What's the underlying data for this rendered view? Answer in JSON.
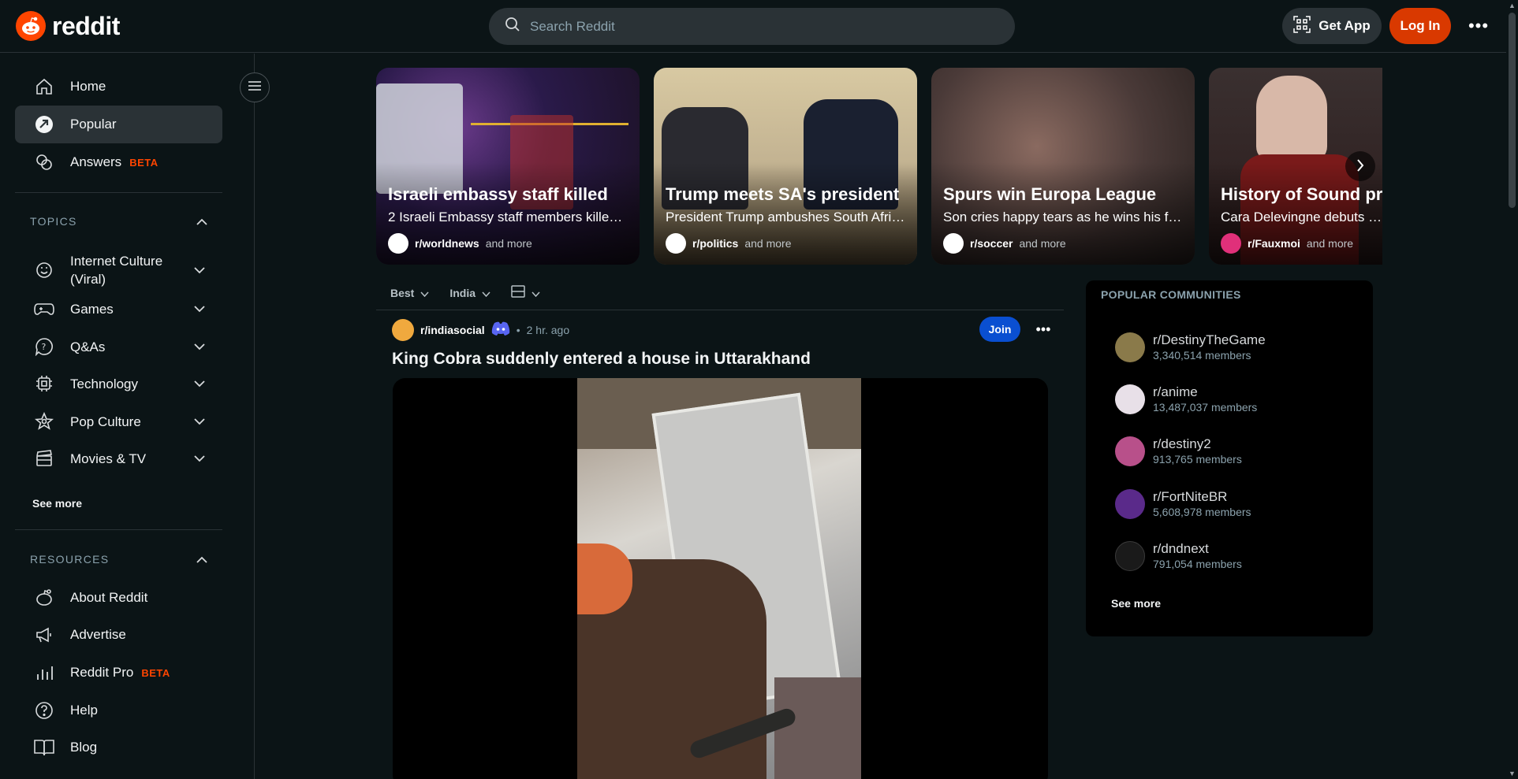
{
  "header": {
    "logo_text": "reddit",
    "search_placeholder": "Search Reddit",
    "get_app_label": "Get App",
    "login_label": "Log In",
    "more_icon": "ellipsis-icon"
  },
  "sidebar": {
    "main_items": [
      {
        "label": "Home",
        "icon": "home-icon"
      },
      {
        "label": "Popular",
        "icon": "popular-icon",
        "active": true
      },
      {
        "label": "Answers",
        "icon": "answers-icon",
        "badge": "BETA"
      }
    ],
    "topics_header": "TOPICS",
    "topics": [
      {
        "label": "Internet Culture (Viral)",
        "icon": "internet-culture-icon"
      },
      {
        "label": "Games",
        "icon": "gamepad-icon"
      },
      {
        "label": "Q&As",
        "icon": "question-icon"
      },
      {
        "label": "Technology",
        "icon": "chip-icon"
      },
      {
        "label": "Pop Culture",
        "icon": "star-icon"
      },
      {
        "label": "Movies & TV",
        "icon": "clapperboard-icon"
      }
    ],
    "see_more": "See more",
    "resources_header": "RESOURCES",
    "resources": [
      {
        "label": "About Reddit",
        "icon": "reddit-alien-icon"
      },
      {
        "label": "Advertise",
        "icon": "megaphone-icon"
      },
      {
        "label": "Reddit Pro",
        "icon": "bar-chart-icon",
        "badge": "BETA"
      },
      {
        "label": "Help",
        "icon": "help-icon"
      },
      {
        "label": "Blog",
        "icon": "book-icon"
      }
    ]
  },
  "carousel": {
    "cards": [
      {
        "title": "Israeli embassy staff killed",
        "subtitle": "2 Israeli Embassy staff members killed i...",
        "subreddit": "r/worldnews",
        "more": "and more"
      },
      {
        "title": "Trump meets SA's president",
        "subtitle": "President Trump ambushes South Afric...",
        "subreddit": "r/politics",
        "more": "and more"
      },
      {
        "title": "Spurs win Europa League",
        "subtitle": "Son cries happy tears as he wins his firs...",
        "subreddit": "r/soccer",
        "more": "and more"
      },
      {
        "title": "History of Sound pre",
        "subtitle": "Cara Delevingne debuts dar",
        "subreddit": "r/Fauxmoi",
        "more": "and more"
      }
    ]
  },
  "sortbar": {
    "sort": "Best",
    "region": "India",
    "view_icon": "card-view-icon"
  },
  "post": {
    "subreddit": "r/indiasocial",
    "separator": "•",
    "time": "2 hr. ago",
    "join_label": "Join",
    "title": "King Cobra suddenly entered a house in Uttarakhand"
  },
  "popular_communities": {
    "title": "POPULAR COMMUNITIES",
    "items": [
      {
        "name": "r/DestinyTheGame",
        "members": "3,340,514 members",
        "color": "#8a7a4a"
      },
      {
        "name": "r/anime",
        "members": "13,487,037 members",
        "color": "#e8e0e8"
      },
      {
        "name": "r/destiny2",
        "members": "913,765 members",
        "color": "#b8508a"
      },
      {
        "name": "r/FortNiteBR",
        "members": "5,608,978 members",
        "color": "#5a2a8a"
      },
      {
        "name": "r/dndnext",
        "members": "791,054 members",
        "color": "#1a1a1a"
      }
    ],
    "see_more": "See more"
  },
  "colors": {
    "background": "#0b1416",
    "accent": "#d93900",
    "join": "#0a4fd1",
    "beta": "#ff4500"
  }
}
